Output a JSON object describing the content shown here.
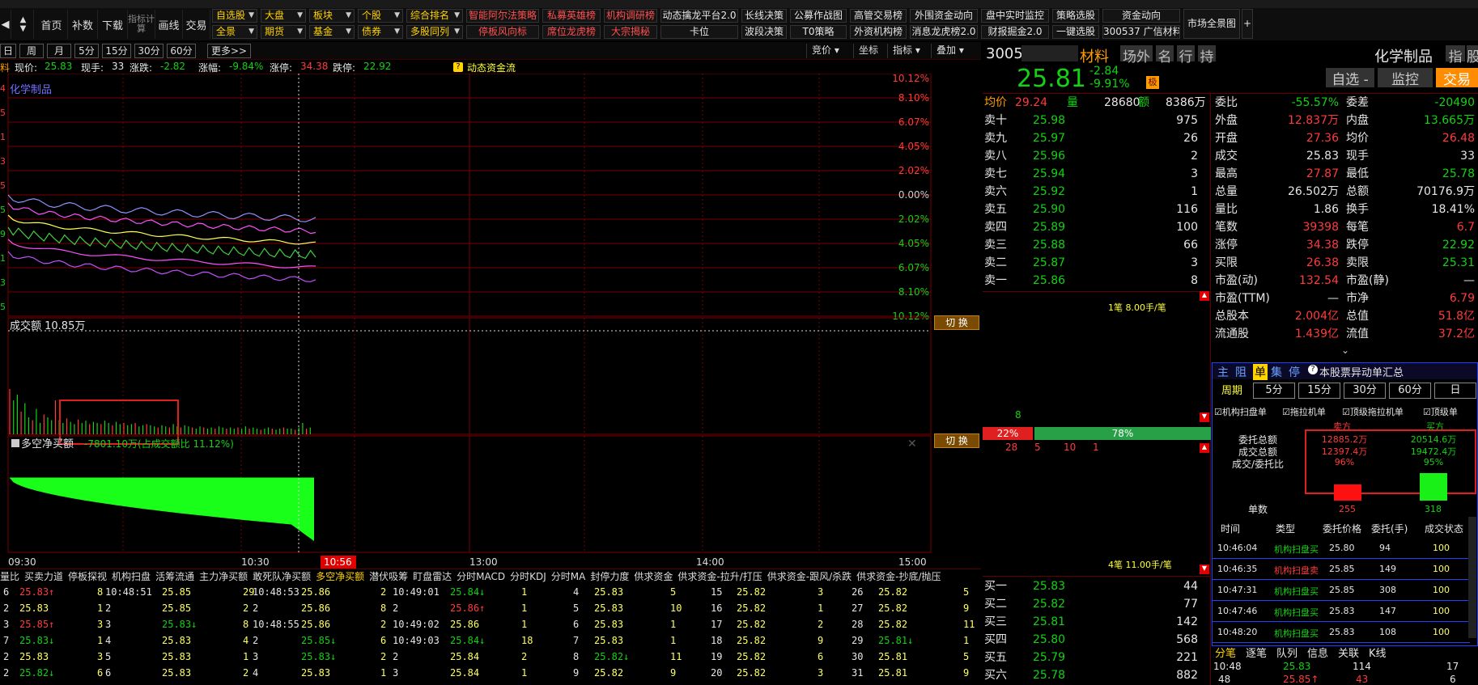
{
  "nav": {
    "buttons": [
      "首页",
      "补数",
      "下载",
      "指标计算",
      "画线",
      "交易"
    ]
  },
  "select_row1": [
    "自选股",
    "大盘",
    "板块",
    "个股",
    "综合排名"
  ],
  "select_row2": [
    "全景",
    "期货",
    "基金",
    "债券",
    "多股同列"
  ],
  "quick_row1": [
    "智能阿尔法策略",
    "私募英雄榜",
    "机构调研榜",
    "动态擒龙平台2.0",
    "长线决策",
    "公募作战图",
    "高管交易榜",
    "外围资金动向",
    "盘中实时监控",
    "策略选股",
    "资金动向",
    "市场全景图"
  ],
  "quick_row2": [
    "停板风向标",
    "席位龙虎榜",
    "大宗揭秘",
    "卡位",
    "波段决策",
    "T0策略",
    "外资机构榜",
    "消息龙虎榜2.0",
    "财报掘金2.0",
    "一键选股",
    "300537 广信材料"
  ],
  "periods": [
    "日",
    "周",
    "月",
    "5分",
    "15分",
    "30分",
    "60分",
    "更多>>"
  ],
  "right_tools": [
    "竞价",
    "坐标",
    "指标",
    "叠加"
  ],
  "info": {
    "price_lbl": "现价:",
    "price": "25.83",
    "hand_lbl": "现手:",
    "hand": "33",
    "chg_lbl": "涨跌:",
    "chg": "-2.82",
    "pct_lbl": "涨幅:",
    "pct": "-9.84%",
    "up_lbl": "涨停:",
    "up": "34.38",
    "dn_lbl": "跌停:",
    "dn": "22.92",
    "flow": "动态资金流"
  },
  "chart": {
    "industry": "化学制品",
    "pct_axis": [
      "10.12%",
      "8.10%",
      "6.07%",
      "4.05%",
      "2.02%",
      "0.00%",
      "2.02%",
      "4.05%",
      "6.07%",
      "8.10%",
      "10.12%"
    ],
    "vol_title": "成交额 10.85万",
    "net_title": "多空净买额",
    "net_value": "-7801.10万(占成交额比 11.12%)",
    "switch": "切 换",
    "times": [
      "09:30",
      "10:30",
      "10:56",
      "13:00",
      "14:00",
      "15:00"
    ],
    "left_axis": [
      "4",
      "5",
      "1",
      "3",
      "5",
      "5",
      "9",
      "1",
      "3",
      "5"
    ]
  },
  "bottom_tabs": [
    "量比",
    "买卖力道",
    "停板探视",
    "机构扫盘",
    "活筹流通",
    "主力净买额",
    "敢死队净买额",
    "多空净买额",
    "潜伏吸筹",
    "盯盘雷达",
    "分时MACD",
    "分时KDJ",
    "分时MA",
    "封停力度",
    "供求资金",
    "供求资金-拉升/打压",
    "供求资金-跟风/杀跌",
    "供求资金-抄底/抛压"
  ],
  "tick_rows": [
    [
      "6",
      "25.83↑",
      "8",
      "10:48:51",
      "25.85",
      "29",
      "10:48:53",
      "25.86",
      "2",
      "10:49:01",
      "25.84↓",
      "1",
      "4",
      "25.83",
      "5",
      "15",
      "25.82",
      "3",
      "26",
      "25.82",
      "5"
    ],
    [
      "2",
      "25.83",
      "1",
      "2",
      "25.85",
      "2",
      "2",
      "25.86",
      "8",
      "2",
      "25.86↑",
      "1",
      "5",
      "25.83",
      "10",
      "16",
      "25.82",
      "1",
      "27",
      "25.82",
      "9"
    ],
    [
      "3",
      "25.85↑",
      "3",
      "3",
      "25.83↓",
      "8",
      "10:48:55",
      "25.86",
      "2",
      "10:49:02",
      "25.86",
      "1",
      "6",
      "25.83",
      "1",
      "17",
      "25.82",
      "2",
      "28",
      "25.82",
      "11"
    ],
    [
      "7",
      "25.83↓",
      "1",
      "4",
      "25.83",
      "4",
      "2",
      "25.85↓",
      "6",
      "10:49:03",
      "25.84↓",
      "18",
      "7",
      "25.83",
      "1",
      "18",
      "25.82",
      "9",
      "29",
      "25.81↓",
      "1"
    ],
    [
      "2",
      "25.83",
      "3",
      "5",
      "25.83",
      "1",
      "3",
      "25.83↓",
      "2",
      "2",
      "25.84",
      "2",
      "8",
      "25.82↓",
      "11",
      "19",
      "25.82",
      "6",
      "30",
      "25.81",
      "5"
    ],
    [
      "2",
      "25.82↓",
      "6",
      "6",
      "25.83",
      "2",
      "4",
      "25.83",
      "1",
      "3",
      "25.84",
      "1",
      "9",
      "25.82",
      "9",
      "20",
      "25.82",
      "3",
      "31",
      "25.81",
      "9"
    ]
  ],
  "stock": {
    "code": "3005",
    "name_tail": "材料",
    "tags": [
      "场外",
      "名",
      "行",
      "持"
    ],
    "price": "25.81",
    "chg": "-2.84",
    "pct": "-9.91%",
    "badge": "极",
    "industry": "化学制品",
    "tools": [
      "指",
      "股"
    ],
    "btns": [
      "自选 -",
      "监控",
      "交易"
    ]
  },
  "ob": {
    "avg_lbl": "均价",
    "avg": "29.24",
    "vol_lbl": "量",
    "vol": "28680",
    "amt_lbl": "额",
    "amt": "8386万",
    "asks": [
      [
        "卖十",
        "25.98",
        "975"
      ],
      [
        "卖九",
        "25.97",
        "26"
      ],
      [
        "卖八",
        "25.96",
        "2"
      ],
      [
        "卖七",
        "25.94",
        "3"
      ],
      [
        "卖六",
        "25.92",
        "1"
      ],
      [
        "卖五",
        "25.90",
        "116"
      ],
      [
        "卖四",
        "25.89",
        "100"
      ],
      [
        "卖三",
        "25.88",
        "66"
      ],
      [
        "卖二",
        "25.87",
        "3"
      ],
      [
        "卖一",
        "25.86",
        "8"
      ]
    ],
    "bids": [
      [
        "买一",
        "25.83",
        "44"
      ],
      [
        "买二",
        "25.82",
        "77"
      ],
      [
        "买三",
        "25.81",
        "142"
      ],
      [
        "买四",
        "25.80",
        "568"
      ],
      [
        "买五",
        "25.79",
        "221"
      ],
      [
        "买六",
        "25.78",
        "882"
      ]
    ],
    "q1": "1笔 8.00手/笔",
    "q1n": "8",
    "ratio_l": "22%",
    "ratio_r": "78%",
    "seq": [
      "28",
      "5",
      "10",
      "1"
    ],
    "q2": "4笔 11.00手/笔"
  },
  "fund": [
    [
      "委比",
      "-55.57%",
      "委差",
      "-20490"
    ],
    [
      "外盘",
      "12.837万",
      "内盘",
      "13.665万"
    ],
    [
      "开盘",
      "27.36",
      "均价",
      "26.48"
    ],
    [
      "成交",
      "25.83",
      "现手",
      "33"
    ],
    [
      "最高",
      "27.87",
      "最低",
      "25.78"
    ],
    [
      "总量",
      "26.502万",
      "总额",
      "70176.9万"
    ],
    [
      "量比",
      "1.86",
      "换手",
      "18.41%"
    ],
    [
      "笔数",
      "39398",
      "每笔",
      "6.7"
    ],
    [
      "涨停",
      "34.38",
      "跌停",
      "22.92"
    ],
    [
      "买限",
      "26.38",
      "卖限",
      "25.31"
    ],
    [
      "市盈(动)",
      "132.54",
      "市盈(静)",
      "—"
    ],
    [
      "市盈(TTM)",
      "—",
      "市净",
      "6.79"
    ],
    [
      "总股本",
      "2.004亿",
      "总值",
      "51.8亿"
    ],
    [
      "流通股",
      "1.439亿",
      "流值",
      "37.2亿"
    ]
  ],
  "abn": {
    "tabs": [
      "主",
      "阻",
      "单",
      "集",
      "停"
    ],
    "title": "本股票异动单汇总",
    "period_lbl": "周期",
    "periods": [
      "5分",
      "15分",
      "30分",
      "60分",
      "日"
    ],
    "checks": [
      "机构扫盘单",
      "拖拉机单",
      "顶级拖拉机单",
      "顶级单"
    ],
    "col_sell": "卖方",
    "col_buy": "买方",
    "rows": [
      [
        "委托总额",
        "12885.2万",
        "20514.6万"
      ],
      [
        "成交总额",
        "12397.4万",
        "19472.4万"
      ],
      [
        "成交/委托比",
        "96%",
        "95%"
      ]
    ],
    "count_lbl": "单数",
    "sell_n": "255",
    "buy_n": "318",
    "heads": [
      "时间",
      "类型",
      "委托价格",
      "委托(手)",
      "成交状态"
    ],
    "list": [
      [
        "10:46:04",
        "机构扫盘买",
        "25.80",
        "94",
        "100"
      ],
      [
        "10:46:35",
        "机构扫盘卖",
        "25.85",
        "149",
        "100"
      ],
      [
        "10:47:31",
        "机构扫盘买",
        "25.85",
        "308",
        "100"
      ],
      [
        "10:47:46",
        "机构扫盘买",
        "25.83",
        "147",
        "100"
      ],
      [
        "10:48:20",
        "机构扫盘买",
        "25.83",
        "108",
        "100"
      ]
    ]
  },
  "bot": {
    "tabs": [
      "分笔",
      "逐笔",
      "队列",
      "信息",
      "关联",
      "K线"
    ],
    "r1": [
      "10:48",
      "25.83",
      "114",
      "17"
    ],
    "r2": [
      "48",
      "25.85↑",
      "43",
      "6"
    ]
  },
  "colors": {
    "up": "#ff3b3b",
    "down": "#13d213",
    "grid": "#7a0000",
    "net": "#1aff1a"
  }
}
